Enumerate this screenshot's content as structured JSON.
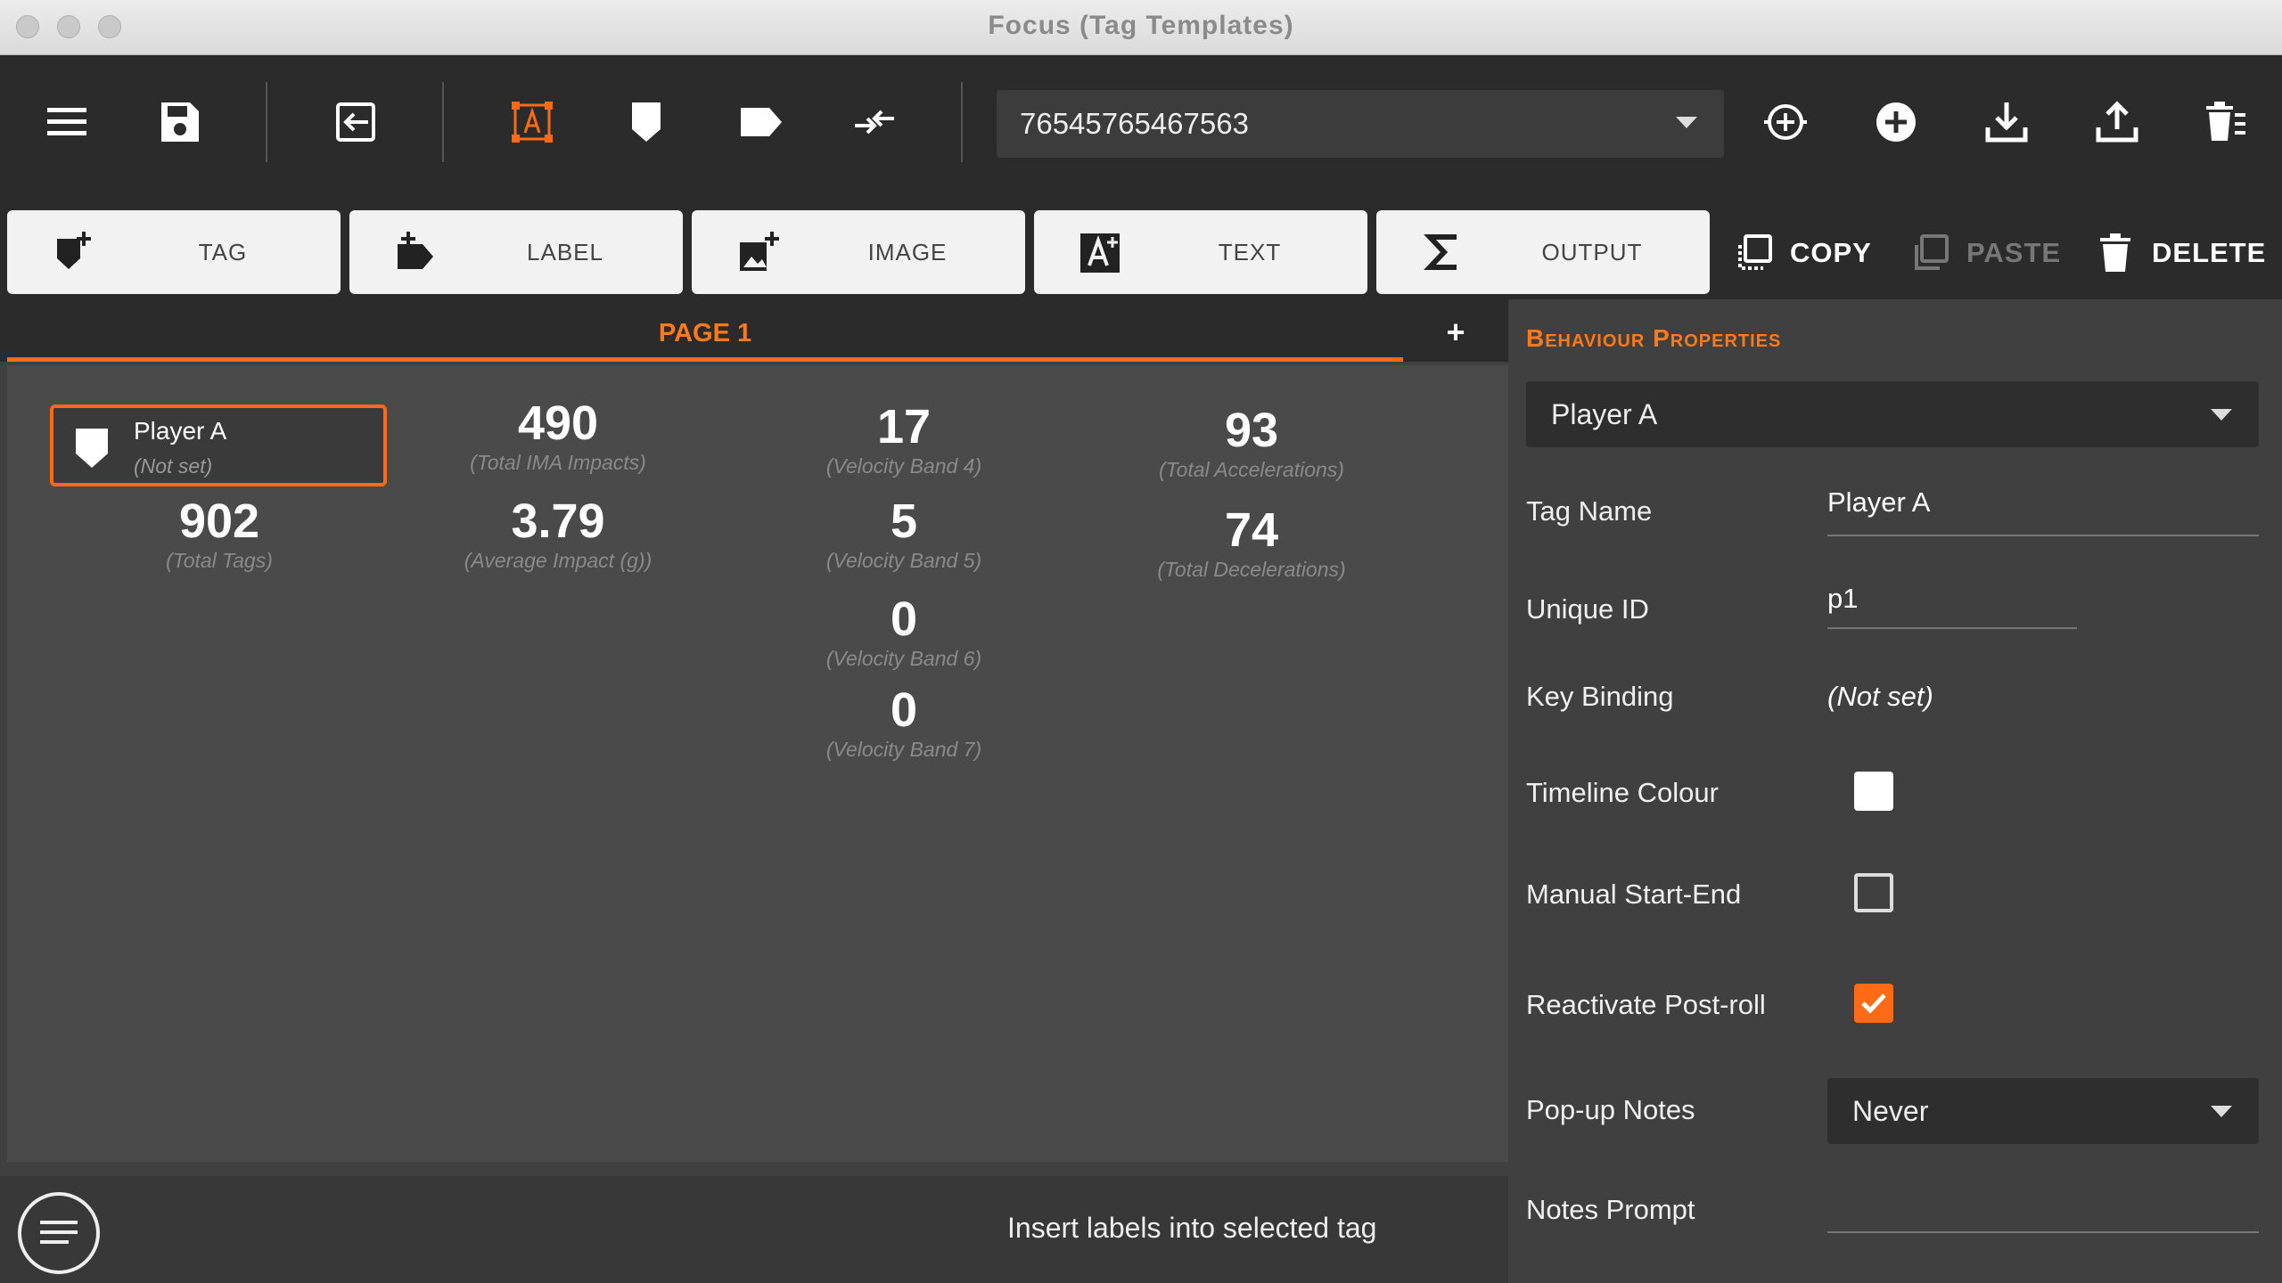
{
  "window": {
    "title": "Focus (Tag Templates)"
  },
  "toolbar": {
    "icons": [
      "menu-icon",
      "save-icon",
      "exit-icon",
      "text-frame-icon",
      "shield-icon",
      "label-icon",
      "merge-arrows-icon",
      "target-add-icon",
      "plus-circle-icon",
      "download-icon",
      "upload-icon",
      "trash-stack-icon"
    ],
    "dataset_value": "76545765467563",
    "active_color": "#ff6a14"
  },
  "add_buttons": [
    {
      "label": "TAG",
      "icon": "add-tag-icon"
    },
    {
      "label": "LABEL",
      "icon": "add-label-icon"
    },
    {
      "label": "IMAGE",
      "icon": "add-image-icon"
    },
    {
      "label": "TEXT",
      "icon": "add-text-icon"
    },
    {
      "label": "OUTPUT",
      "icon": "sigma-icon"
    }
  ],
  "actions": {
    "copy": "COPY",
    "paste": "PASTE",
    "delete": "DELETE"
  },
  "page": {
    "tab_label": "PAGE 1",
    "add_tab": "+"
  },
  "selected_tag": {
    "name": "Player A",
    "key": "(Not set)"
  },
  "stats": [
    {
      "value": "902",
      "caption": "(Total Tags)"
    },
    {
      "value": "490",
      "caption": "(Total IMA Impacts)"
    },
    {
      "value": "3.79",
      "caption": "(Average Impact (g))"
    },
    {
      "value": "17",
      "caption": "(Velocity Band 4)"
    },
    {
      "value": "5",
      "caption": "(Velocity Band 5)"
    },
    {
      "value": "0",
      "caption": "(Velocity Band 6)"
    },
    {
      "value": "0",
      "caption": "(Velocity Band 7)"
    },
    {
      "value": "93",
      "caption": "(Total Accelerations)"
    },
    {
      "value": "74",
      "caption": "(Total Decelerations)"
    }
  ],
  "status": {
    "message": "Insert labels into selected tag"
  },
  "panel": {
    "title": "Behaviour Properties",
    "selected_tag": "Player A",
    "tag_name_label": "Tag Name",
    "tag_name_value": "Player A",
    "unique_id_label": "Unique ID",
    "unique_id_value": "p1",
    "key_binding_label": "Key Binding",
    "key_binding_value": "(Not set)",
    "timeline_colour_label": "Timeline Colour",
    "timeline_colour": "#ffffff",
    "manual_start_end_label": "Manual Start-End",
    "manual_start_end_checked": false,
    "reactivate_postroll_label": "Reactivate Post-roll",
    "reactivate_postroll_checked": true,
    "popup_notes_label": "Pop-up Notes",
    "popup_notes_value": "Never",
    "notes_prompt_label": "Notes Prompt",
    "notes_prompt_value": ""
  }
}
